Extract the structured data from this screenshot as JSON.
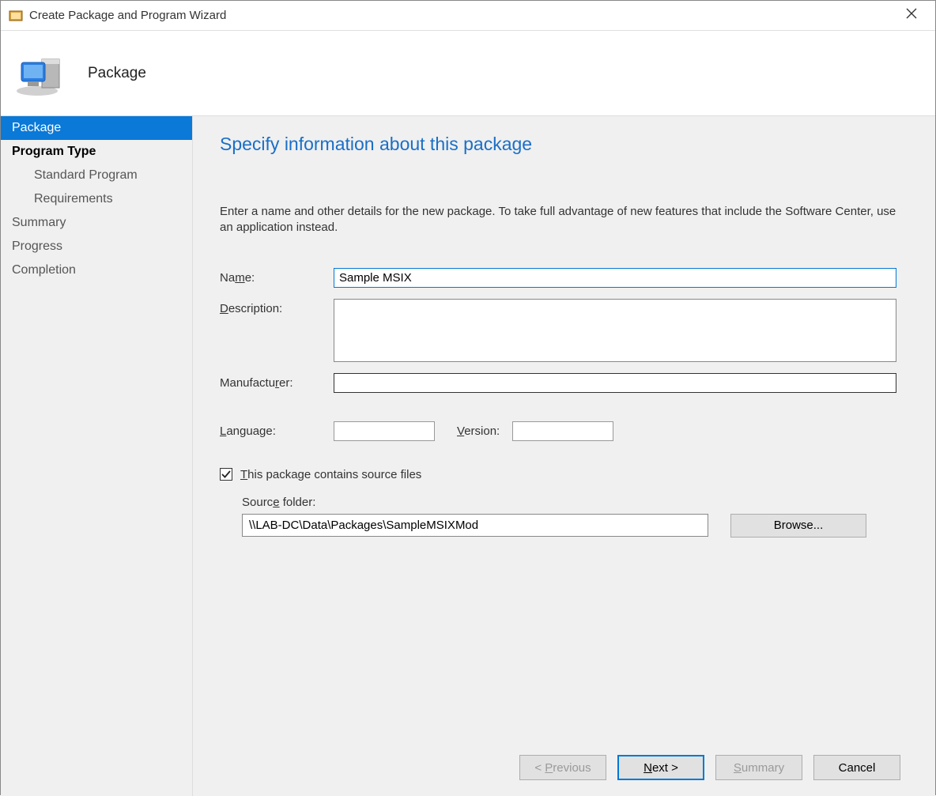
{
  "titlebar": {
    "title": "Create Package and Program Wizard"
  },
  "header": {
    "title": "Package"
  },
  "sidebar": {
    "items": [
      {
        "label": "Package",
        "state": "selected"
      },
      {
        "label": "Program Type",
        "state": "bold"
      },
      {
        "label": "Standard Program",
        "state": "sub"
      },
      {
        "label": "Requirements",
        "state": "sub"
      },
      {
        "label": "Summary",
        "state": "dim"
      },
      {
        "label": "Progress",
        "state": "dim"
      },
      {
        "label": "Completion",
        "state": "dim"
      }
    ]
  },
  "content": {
    "heading": "Specify information about this package",
    "intro": "Enter a name and other details for the new package. To take full advantage of new features that include the Software Center, use an application instead.",
    "labels": {
      "name": "Name:",
      "description": "Description:",
      "manufacturer": "Manufacturer:",
      "language": "Language:",
      "version": "Version:",
      "source_folder": "Source folder:"
    },
    "fields": {
      "name": "Sample MSIX",
      "description": "",
      "manufacturer": "",
      "language": "",
      "version": "",
      "source_folder": "\\\\LAB-DC\\Data\\Packages\\SampleMSIXMod"
    },
    "checkbox": {
      "checked": true,
      "label": "This package contains source files"
    },
    "buttons": {
      "browse": "Browse..."
    }
  },
  "footer": {
    "previous": "< Previous",
    "next": "Next >",
    "summary": "Summary",
    "cancel": "Cancel"
  }
}
